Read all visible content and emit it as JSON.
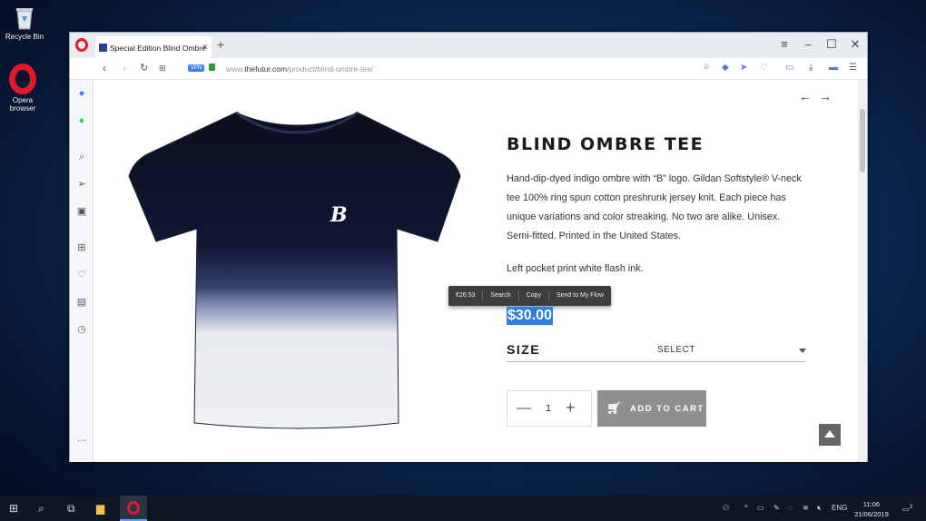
{
  "desktop": {
    "icons": [
      {
        "label": "Recycle Bin"
      },
      {
        "label": "Opera\nbrowser"
      }
    ]
  },
  "browser": {
    "tab_title": "Special Edition Blind Ombre",
    "url_domain": "thefutur.com",
    "url_path": "/product/blind-ombre-tee/",
    "url_prefix": "www.",
    "vpn_label": "VPN"
  },
  "product": {
    "title": "BLIND OMBRE TEE",
    "description": "Hand-dip-dyed indigo ombre with “B” logo. Gildan Softstyle® V-neck tee 100% ring spun cotton preshrunk jersey knit. Each piece has unique variations and color streaking. No two are alike. Unisex. Semi-fitted. Printed in the United States.",
    "pocket_note": "Left pocket print white flash ink.",
    "price": "$30.00",
    "size_label": "SIZE",
    "size_value": "SELECT",
    "quantity": "1",
    "add_to_cart": "ADD TO CART",
    "logo_letter": "B"
  },
  "selection_popup": {
    "items": [
      "€26.53",
      "Search",
      "Copy",
      "Send to My Flow"
    ]
  },
  "taskbar": {
    "language": "ENG",
    "time": "11:06",
    "date": "21/06/2019",
    "notifications": "2"
  },
  "colors": {
    "accent": "#2f7de1",
    "opera_red": "#e0192b",
    "cart_button": "#8f8f8f"
  }
}
